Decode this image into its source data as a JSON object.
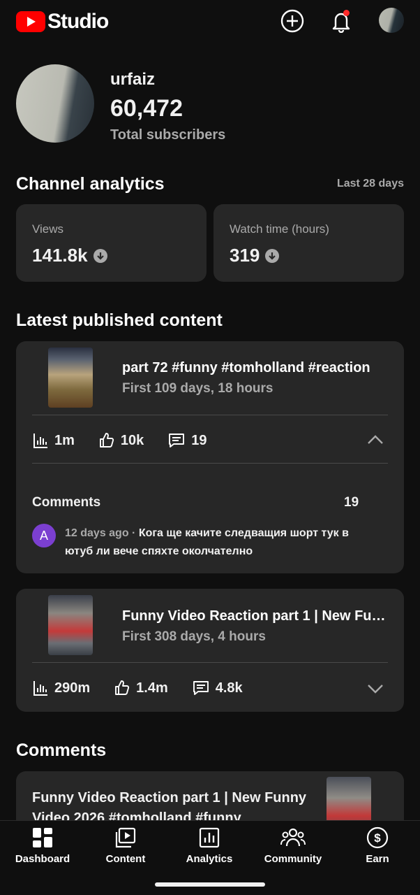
{
  "header": {
    "logo_text": "Studio"
  },
  "channel": {
    "name": "urfaiz",
    "subscribers": "60,472",
    "subscribers_label": "Total subscribers"
  },
  "analytics": {
    "title": "Channel analytics",
    "range": "Last 28 days",
    "cards": [
      {
        "label": "Views",
        "value": "141.8k"
      },
      {
        "label": "Watch time (hours)",
        "value": "319"
      }
    ]
  },
  "latest": {
    "title": "Latest published content",
    "videos": [
      {
        "title": "part 72 #funny #tomholland #reaction",
        "subtitle": "First 109 days, 18 hours",
        "views": "1m",
        "likes": "10k",
        "comments": "19",
        "comments_section": {
          "heading": "Comments",
          "count": "19",
          "avatar_letter": "A",
          "time": "12 days ago",
          "text": "Кога ще качите следващия шорт тук в ютуб ли вече спяхте околчателно"
        }
      },
      {
        "title": "Funny Video Reaction part 1 | New Funny Video 2026",
        "subtitle": "First 308 days, 4 hours",
        "views": "290m",
        "likes": "1.4m",
        "comments": "4.8k"
      }
    ]
  },
  "comments": {
    "title": "Comments",
    "video_title": "Funny Video Reaction part 1 | New Funny Video 2026 #tomholland #funny"
  },
  "nav": [
    {
      "label": "Dashboard",
      "icon": "dashboard-icon"
    },
    {
      "label": "Content",
      "icon": "content-icon"
    },
    {
      "label": "Analytics",
      "icon": "analytics-icon"
    },
    {
      "label": "Community",
      "icon": "community-icon"
    },
    {
      "label": "Earn",
      "icon": "earn-icon"
    }
  ],
  "colors": {
    "brand_red": "#ff0000",
    "background": "#0f0f0f",
    "card": "#272727",
    "muted": "#aaaaaa",
    "avatar_purple": "#7b3fd0"
  }
}
